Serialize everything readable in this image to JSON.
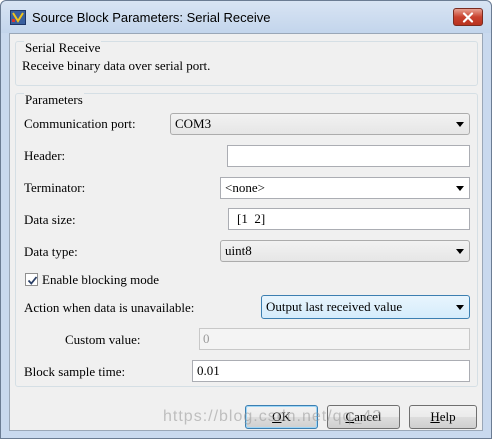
{
  "window": {
    "title": "Source Block Parameters: Serial Receive",
    "icon": "simulink-block-icon"
  },
  "description_group": {
    "title": "Serial Receive",
    "text": "Receive binary data over serial port."
  },
  "parameters": {
    "title": "Parameters",
    "communication_port": {
      "label": "Communication port:",
      "value": "COM3"
    },
    "header": {
      "label": "Header:",
      "value": ""
    },
    "terminator": {
      "label": "Terminator:",
      "value": "<none>"
    },
    "data_size": {
      "label": "Data size:",
      "value": "[1  2]"
    },
    "data_type": {
      "label": "Data type:",
      "value": "uint8"
    },
    "enable_blocking": {
      "label": "Enable blocking mode",
      "checked": true
    },
    "action_unavailable": {
      "label": "Action when data is unavailable:",
      "value": "Output last received value"
    },
    "custom_value": {
      "label": "Custom value:",
      "value": "0"
    },
    "block_sample_time": {
      "label": "Block sample time:",
      "value": "0.01"
    }
  },
  "buttons": {
    "ok": {
      "label": "OK",
      "mnemonic_char": "O",
      "rest": "K"
    },
    "cancel": {
      "label": "Cancel",
      "mnemonic_char": "C",
      "rest": "ancel"
    },
    "help": {
      "label": "Help",
      "mnemonic_char": "H",
      "rest": "elp"
    }
  },
  "watermark": "https://blog.csdn.net/qq_42"
}
